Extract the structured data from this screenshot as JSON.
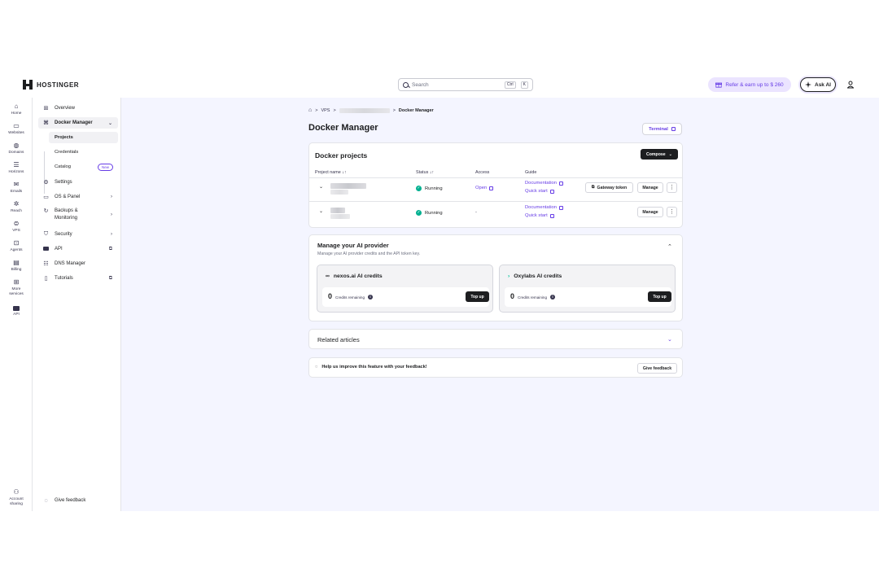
{
  "brand": {
    "name": "HOSTINGER"
  },
  "header": {
    "search_placeholder": "Search",
    "shortcut_ctrl": "Ctrl",
    "shortcut_key": "K",
    "refer_label": "Refer & earn up to $ 260",
    "ask_ai_label": "Ask AI"
  },
  "rail": {
    "items": [
      {
        "label": "Home",
        "icon": "home-icon"
      },
      {
        "label": "Websites",
        "icon": "browser-icon"
      },
      {
        "label": "Domains",
        "icon": "globe-icon"
      },
      {
        "label": "Horizons",
        "icon": "sliders-icon"
      },
      {
        "label": "Emails",
        "icon": "mail-icon"
      },
      {
        "label": "Reach",
        "icon": "sparkle-icon"
      },
      {
        "label": "VPS",
        "icon": "server-icon"
      },
      {
        "label": "Agents",
        "icon": "robot-icon"
      },
      {
        "label": "Billing",
        "icon": "card-icon"
      },
      {
        "label": "More services",
        "icon": "grid-icon"
      },
      {
        "label": "API",
        "icon": "api-icon"
      }
    ],
    "account_sharing": "Account sharing"
  },
  "sidebar": {
    "overview": "Overview",
    "docker_manager": "Docker Manager",
    "projects": "Projects",
    "credentials": "Credentials",
    "catalog": "Catalog",
    "catalog_badge": "New",
    "settings": "Settings",
    "os_panel": "OS & Panel",
    "backups_1": "Backups &",
    "backups_2": "Monitoring",
    "security": "Security",
    "api": "API",
    "dns_manager": "DNS Manager",
    "tutorials": "Tutorials",
    "give_feedback": "Give feedback"
  },
  "breadcrumb": {
    "vps": "VPS",
    "current": "Docker Manager"
  },
  "page": {
    "title": "Docker Manager",
    "terminal_label": "Terminal"
  },
  "projects": {
    "title": "Docker projects",
    "compose_label": "Compose",
    "col_name": "Project name",
    "col_status": "Status",
    "col_access": "Access",
    "col_guide": "Guide",
    "rows": [
      {
        "status": "Running",
        "access": "Open",
        "doc": "Documentation",
        "quick": "Quick start",
        "gateway": "Gateway token",
        "manage": "Manage"
      },
      {
        "status": "Running",
        "access": "-",
        "doc": "Documentation",
        "quick": "Quick start",
        "manage": "Manage"
      }
    ]
  },
  "ai": {
    "title": "Manage your AI provider",
    "subtitle": "Manage your AI provider credits and the API token key.",
    "providers": [
      {
        "name": "nexos.ai AI credits",
        "credits": "0",
        "credits_label": "Credits remaining",
        "topup": "Top up"
      },
      {
        "name": "Oxylabs AI credits",
        "credits": "0",
        "credits_label": "Credits remaining",
        "topup": "Top up"
      }
    ]
  },
  "related": {
    "title": "Related articles"
  },
  "feedback": {
    "text": "Help us improve this feature with your feedback!",
    "button": "Give feedback"
  },
  "colors": {
    "accent": "#673de6",
    "dark": "#1d1e20",
    "success": "#00b090",
    "page_bg": "#f4f5ff"
  }
}
